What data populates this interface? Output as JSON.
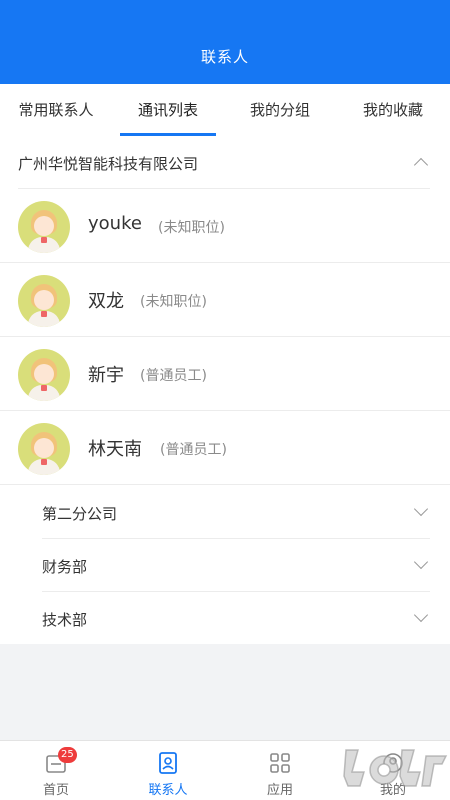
{
  "header": {
    "title": "联系人"
  },
  "tabs": [
    {
      "label": "常用联系人"
    },
    {
      "label": "通讯列表"
    },
    {
      "label": "我的分组"
    },
    {
      "label": "我的收藏"
    }
  ],
  "company": {
    "name": "广州华悦智能科技有限公司"
  },
  "contacts": [
    {
      "name": "youke",
      "role": "(未知职位)"
    },
    {
      "name": "双龙",
      "role": "(未知职位)"
    },
    {
      "name": "新宇",
      "role": "(普通员工)"
    },
    {
      "name": "林天南",
      "role": "(普通员工)"
    }
  ],
  "departments": [
    {
      "label": "第二分公司"
    },
    {
      "label": "财务部"
    },
    {
      "label": "技术部"
    }
  ],
  "bottom_nav": [
    {
      "label": "首页",
      "badge": "25",
      "icon": "home-icon"
    },
    {
      "label": "联系人",
      "icon": "contacts-icon"
    },
    {
      "label": "应用",
      "icon": "apps-icon"
    },
    {
      "label": "我的",
      "icon": "profile-icon"
    }
  ],
  "colors": {
    "accent": "#1677f3",
    "badge": "#ee3c3c",
    "avatar_bg": "#d9de7a"
  }
}
